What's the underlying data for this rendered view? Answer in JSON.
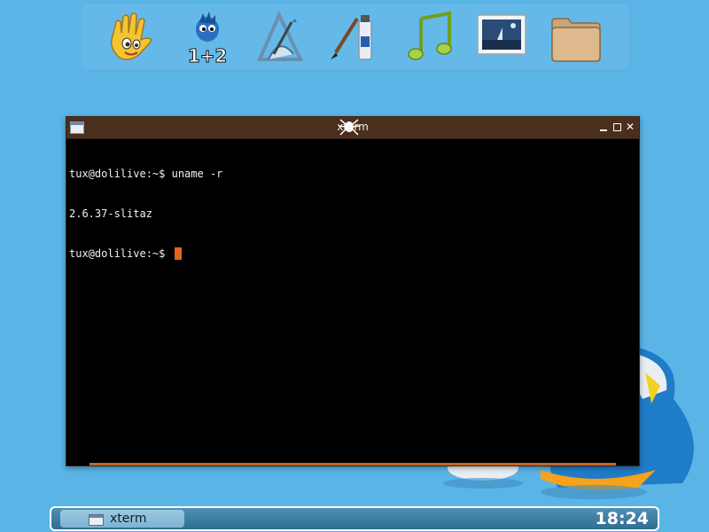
{
  "launcher": {
    "items": [
      {
        "name": "hand-wave-icon"
      },
      {
        "name": "calculator-icon",
        "label": "1+2"
      },
      {
        "name": "vector-drawing-icon"
      },
      {
        "name": "paint-brush-icon"
      },
      {
        "name": "music-note-icon"
      },
      {
        "name": "image-viewer-icon"
      },
      {
        "name": "folder-icon"
      }
    ]
  },
  "window": {
    "title": "xterm",
    "close_glyph": "✕",
    "terminal_lines": [
      "tux@dolilive:~$ uname -r",
      "2.6.37-slitaz",
      "tux@dolilive:~$ "
    ]
  },
  "taskbar": {
    "task_label": "xterm",
    "clock": "18:24"
  },
  "colors": {
    "desktop": "#5ab4e6",
    "titlebar": "#4a2f1d",
    "cursor": "#e0661f",
    "taskbar": "#3a7aa2"
  }
}
